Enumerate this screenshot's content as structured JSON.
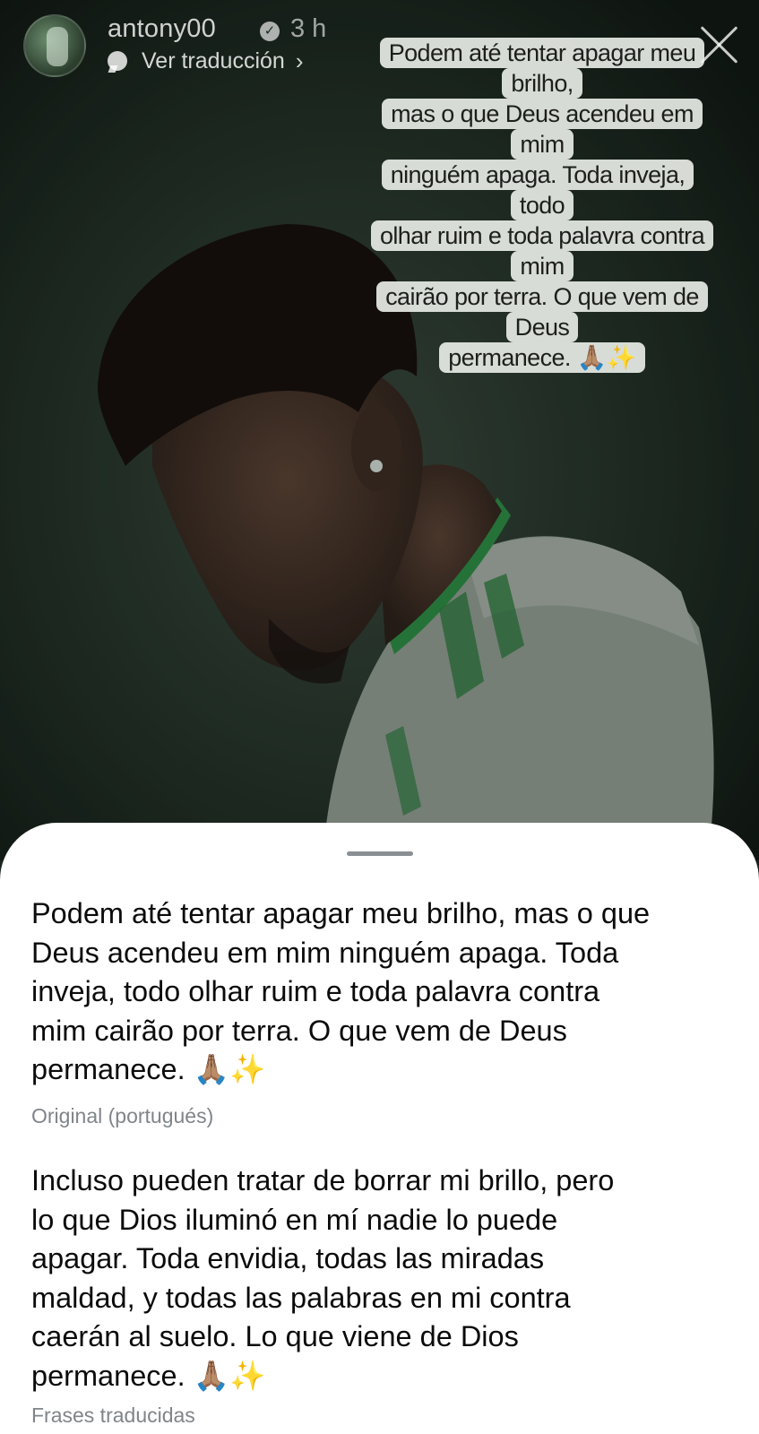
{
  "header": {
    "username": "antony00",
    "verified_glyph": "✓",
    "time_ago": "3 h",
    "see_translation": "Ver traducción",
    "chevron_glyph": "›",
    "icons": [
      "avatar",
      "verified-badge-icon",
      "translate-bubble-icon",
      "chevron-right-icon",
      "close-icon"
    ]
  },
  "sticker": {
    "lines": [
      "Podem até tentar apagar meu brilho,",
      "mas o que Deus acendeu em mim",
      "ninguém apaga. Toda inveja, todo",
      "olhar ruim e toda palavra contra mim",
      "cairão por terra. O que vem de Deus",
      "permanece. 🙏🏽✨"
    ]
  },
  "sheet": {
    "original": {
      "lines": [
        "Podem até tentar apagar meu brilho, mas o que",
        "Deus acendeu em mim ninguém apaga. Toda",
        "inveja, todo olhar ruim e toda palavra contra",
        "mim cairão por terra. O que vem de Deus",
        "permanece. 🙏🏽✨"
      ],
      "caption": "Original (portugués)"
    },
    "translated": {
      "lines": [
        "Incluso pueden tratar de borrar mi brillo, pero",
        "lo que Dios iluminó en mí nadie lo puede",
        "apagar. Toda envidia, todas las miradas",
        "maldad, y todas las palabras en mi contra",
        "caerán al suelo. Lo que viene de Dios",
        "permanece. 🙏🏽✨"
      ],
      "caption": "Frases traducidas"
    }
  },
  "colors": {
    "background_dark": "#1f2b23",
    "sheet_bg": "#ffffff",
    "caption_gray": "#808589",
    "jersey_green": "#2e8b45"
  }
}
